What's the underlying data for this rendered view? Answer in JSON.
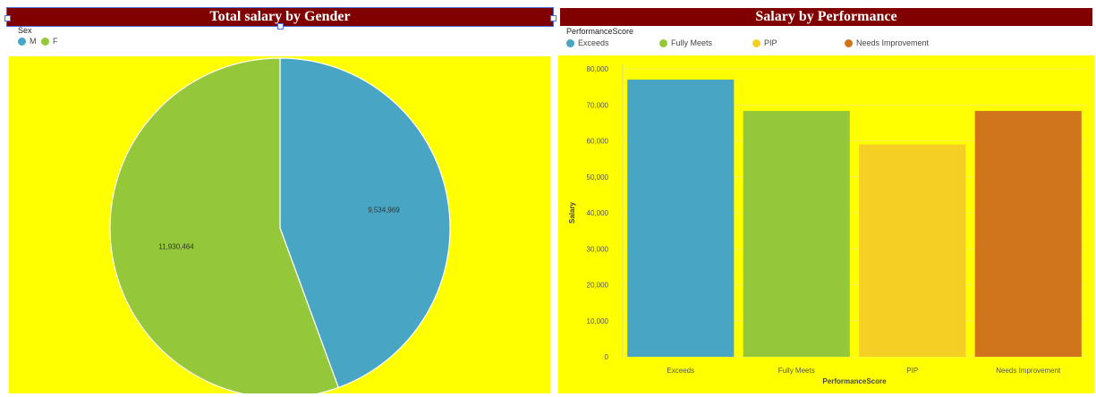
{
  "left": {
    "title": "Total salary by Gender",
    "legend_title": "Sex",
    "legend": [
      {
        "label": "M",
        "color": "#48a5c3"
      },
      {
        "label": "F",
        "color": "#94c83a"
      }
    ]
  },
  "right": {
    "title": "Salary by Performance",
    "legend_title": "PerformanceScore",
    "legend": [
      {
        "label": "Exceeds",
        "color": "#48a5c3"
      },
      {
        "label": "Fully Meets",
        "color": "#94c83a"
      },
      {
        "label": "PIP",
        "color": "#f6cf25"
      },
      {
        "label": "Needs Improvement",
        "color": "#d0751b"
      }
    ]
  },
  "chart_data": [
    {
      "type": "pie",
      "title": "Total salary by Gender",
      "legend_title": "Sex",
      "slices": [
        {
          "label": "M",
          "value": 9534969,
          "display": "9,534,969",
          "color": "#48a5c3"
        },
        {
          "label": "F",
          "value": 11930464,
          "display": "11,930,464",
          "color": "#94c83a"
        }
      ],
      "start": "top",
      "direction": "clockwise",
      "background": "#ffff00"
    },
    {
      "type": "bar",
      "title": "Salary by Performance",
      "legend_title": "PerformanceScore",
      "categories": [
        "Exceeds",
        "Fully Meets",
        "PIP",
        "Needs Improvement"
      ],
      "values": [
        77000,
        68300,
        59000,
        68300
      ],
      "colors": [
        "#48a5c3",
        "#94c83a",
        "#f6cf25",
        "#d0751b"
      ],
      "xlabel": "PerformanceScore",
      "ylabel": "Salary",
      "ylim": [
        0,
        80000
      ],
      "yticks": [
        0,
        10000,
        20000,
        30000,
        40000,
        50000,
        60000,
        70000,
        80000
      ],
      "ytick_labels": [
        "0",
        "10,000",
        "20,000",
        "30,000",
        "40,000",
        "50,000",
        "60,000",
        "70,000",
        "80,000"
      ],
      "grid": true,
      "legend_position": "top-left",
      "background": "#ffff00"
    }
  ]
}
